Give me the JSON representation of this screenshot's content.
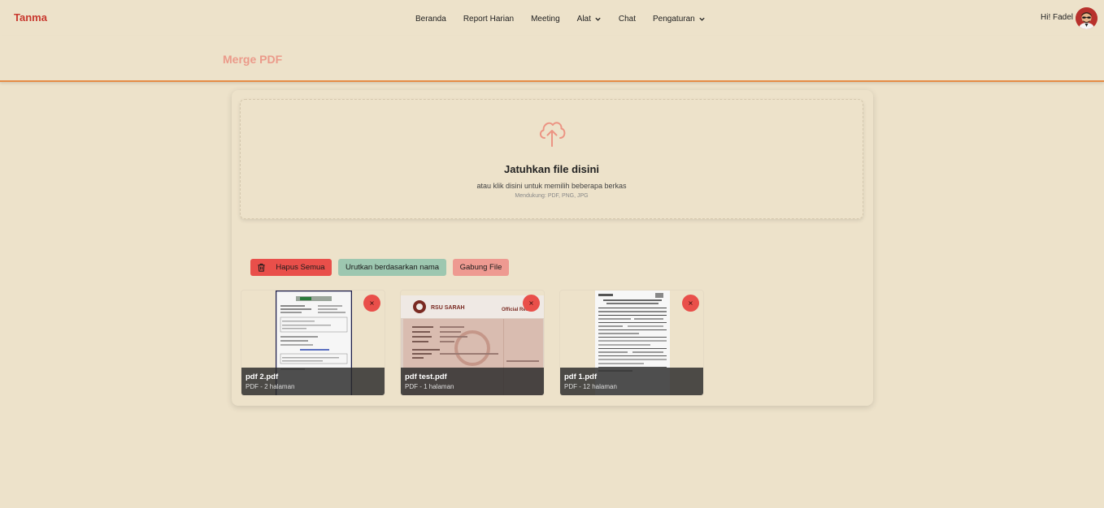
{
  "brand": "Tanma",
  "nav": {
    "items": [
      {
        "label": "Beranda"
      },
      {
        "label": "Report Harian"
      },
      {
        "label": "Meeting"
      },
      {
        "label": "Alat"
      },
      {
        "label": "Chat"
      },
      {
        "label": "Pengaturan"
      }
    ]
  },
  "user": {
    "greeting": "Hi! Fadel"
  },
  "page": {
    "title": "Merge PDF"
  },
  "dropzone": {
    "title": "Jatuhkan file disini",
    "subtitle": "atau klik disini untuk memilih beberapa berkas",
    "formats": "Mendukung: PDF, PNG, JPG"
  },
  "actions": {
    "clear": "Hapus Semua",
    "sort": "Urutkan berdasarkan nama",
    "merge": "Gabung File"
  },
  "files": [
    {
      "name": "pdf 2.pdf",
      "meta": "PDF - 2 halaman",
      "remove": "×"
    },
    {
      "name": "pdf test.pdf",
      "meta": "PDF - 1 halaman",
      "remove": "×",
      "thumb_text": "RSU SARAH",
      "thumb_badge": "Official Rec"
    },
    {
      "name": "pdf 1.pdf",
      "meta": "PDF - 12 halaman",
      "remove": "×"
    }
  ],
  "colors": {
    "background": "#ede2ca",
    "brand": "#c8382e",
    "accent_line": "#e58c46",
    "title": "#eb9a8a",
    "danger": "#e94f4a",
    "sort": "#9dc7b0",
    "merge": "#ee9a91"
  }
}
